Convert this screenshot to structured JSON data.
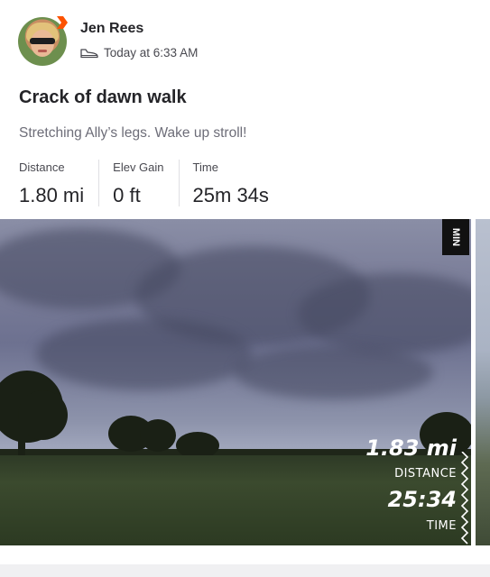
{
  "athlete": {
    "name": "Jen Rees"
  },
  "activity": {
    "timestamp": "Today at 6:33 AM",
    "type_icon": "shoe-icon",
    "title": "Crack of dawn walk",
    "description": "Stretching Ally’s legs.  Wake up stroll!"
  },
  "stats": [
    {
      "label": "Distance",
      "value": "1.80 mi"
    },
    {
      "label": "Elev Gain",
      "value": "0 ft"
    },
    {
      "label": "Time",
      "value": "25m 34s"
    }
  ],
  "photo_overlay": {
    "distance_value": "1.83 mi",
    "distance_label": "DISTANCE",
    "time_value": "25:34",
    "time_label": "TIME",
    "corner_tag": "MIN"
  },
  "colors": {
    "brand": "#fc5200",
    "text": "#242428",
    "muted": "#6d6d78"
  }
}
